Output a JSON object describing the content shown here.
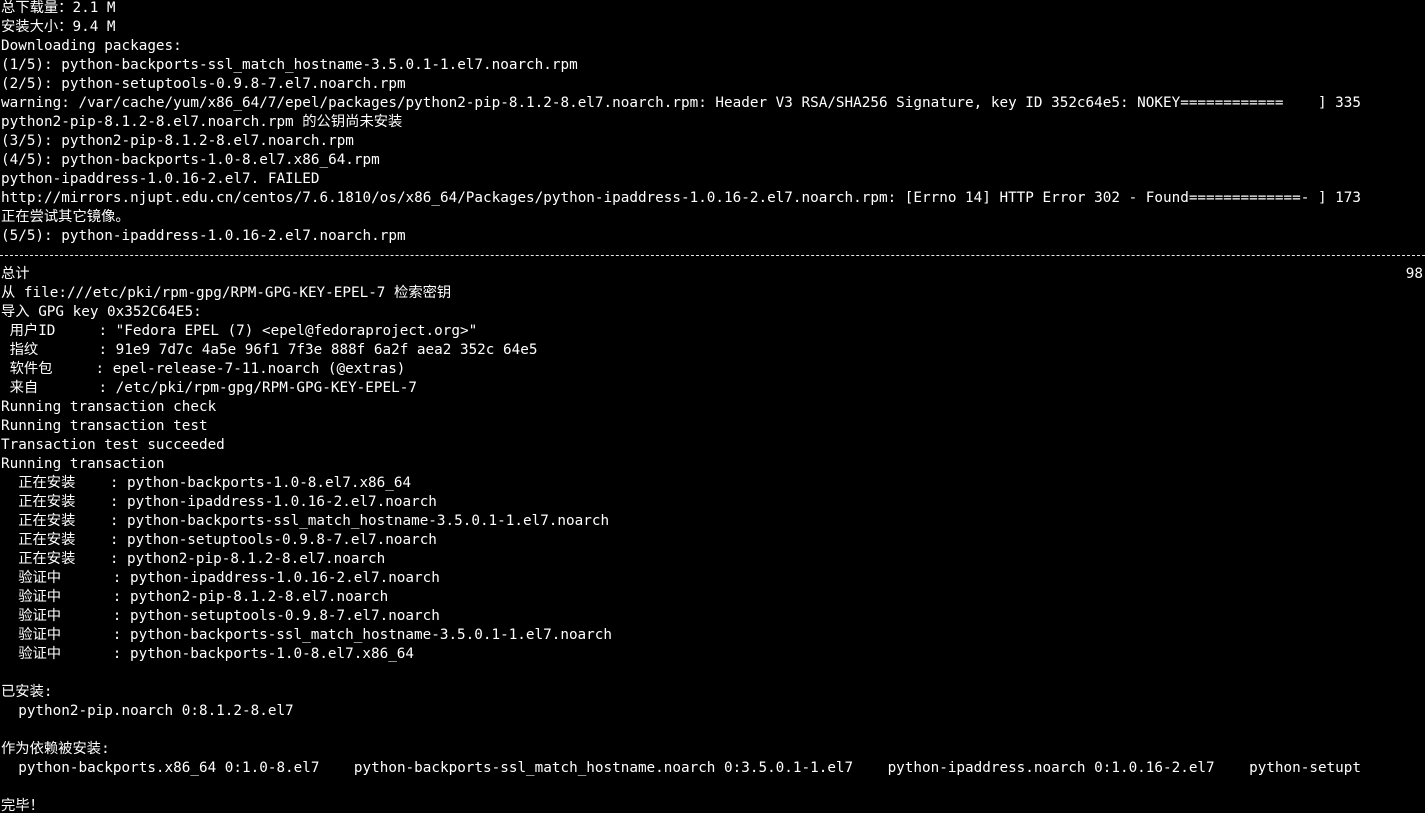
{
  "terminal": {
    "lines": [
      "总下载量：2.1 M",
      "安装大小：9.4 M",
      "Downloading packages:",
      "(1/5): python-backports-ssl_match_hostname-3.5.0.1-1.el7.noarch.rpm",
      "(2/5): python-setuptools-0.9.8-7.el7.noarch.rpm",
      "warning: /var/cache/yum/x86_64/7/epel/packages/python2-pip-8.1.2-8.el7.noarch.rpm: Header V3 RSA/SHA256 Signature, key ID 352c64e5: NOKEY============    ] 335",
      "python2-pip-8.1.2-8.el7.noarch.rpm 的公钥尚未安装",
      "(3/5): python2-pip-8.1.2-8.el7.noarch.rpm",
      "(4/5): python-backports-1.0-8.el7.x86_64.rpm",
      "python-ipaddress-1.0.16-2.el7. FAILED",
      "http://mirrors.njupt.edu.cn/centos/7.6.1810/os/x86_64/Packages/python-ipaddress-1.0.16-2.el7.noarch.rpm: [Errno 14] HTTP Error 302 - Found=============- ] 173",
      "正在尝试其它镜像。",
      "(5/5): python-ipaddress-1.0.16-2.el7.noarch.rpm",
      "",
      "总计",
      "从 file:///etc/pki/rpm-gpg/RPM-GPG-KEY-EPEL-7 检索密钥",
      "导入 GPG key 0x352C64E5:",
      " 用户ID     : \"Fedora EPEL (7) <epel@fedoraproject.org>\"",
      " 指纹       : 91e9 7d7c 4a5e 96f1 7f3e 888f 6a2f aea2 352c 64e5",
      " 软件包     : epel-release-7-11.noarch (@extras)",
      " 来自       : /etc/pki/rpm-gpg/RPM-GPG-KEY-EPEL-7",
      "Running transaction check",
      "Running transaction test",
      "Transaction test succeeded",
      "Running transaction",
      "  正在安装    : python-backports-1.0-8.el7.x86_64",
      "  正在安装    : python-ipaddress-1.0.16-2.el7.noarch",
      "  正在安装    : python-backports-ssl_match_hostname-3.5.0.1-1.el7.noarch",
      "  正在安装    : python-setuptools-0.9.8-7.el7.noarch",
      "  正在安装    : python2-pip-8.1.2-8.el7.noarch",
      "  验证中      : python-ipaddress-1.0.16-2.el7.noarch",
      "  验证中      : python2-pip-8.1.2-8.el7.noarch",
      "  验证中      : python-setuptools-0.9.8-7.el7.noarch",
      "  验证中      : python-backports-ssl_match_hostname-3.5.0.1-1.el7.noarch",
      "  验证中      : python-backports-1.0-8.el7.x86_64",
      "",
      "已安装:",
      "  python2-pip.noarch 0:8.1.2-8.el7",
      "",
      "作为依赖被安装:",
      "  python-backports.x86_64 0:1.0-8.el7    python-backports-ssl_match_hostname.noarch 0:3.5.0.1-1.el7    python-ipaddress.noarch 0:1.0.16-2.el7    python-setupt",
      "",
      "完毕！"
    ],
    "total_right": "98"
  }
}
